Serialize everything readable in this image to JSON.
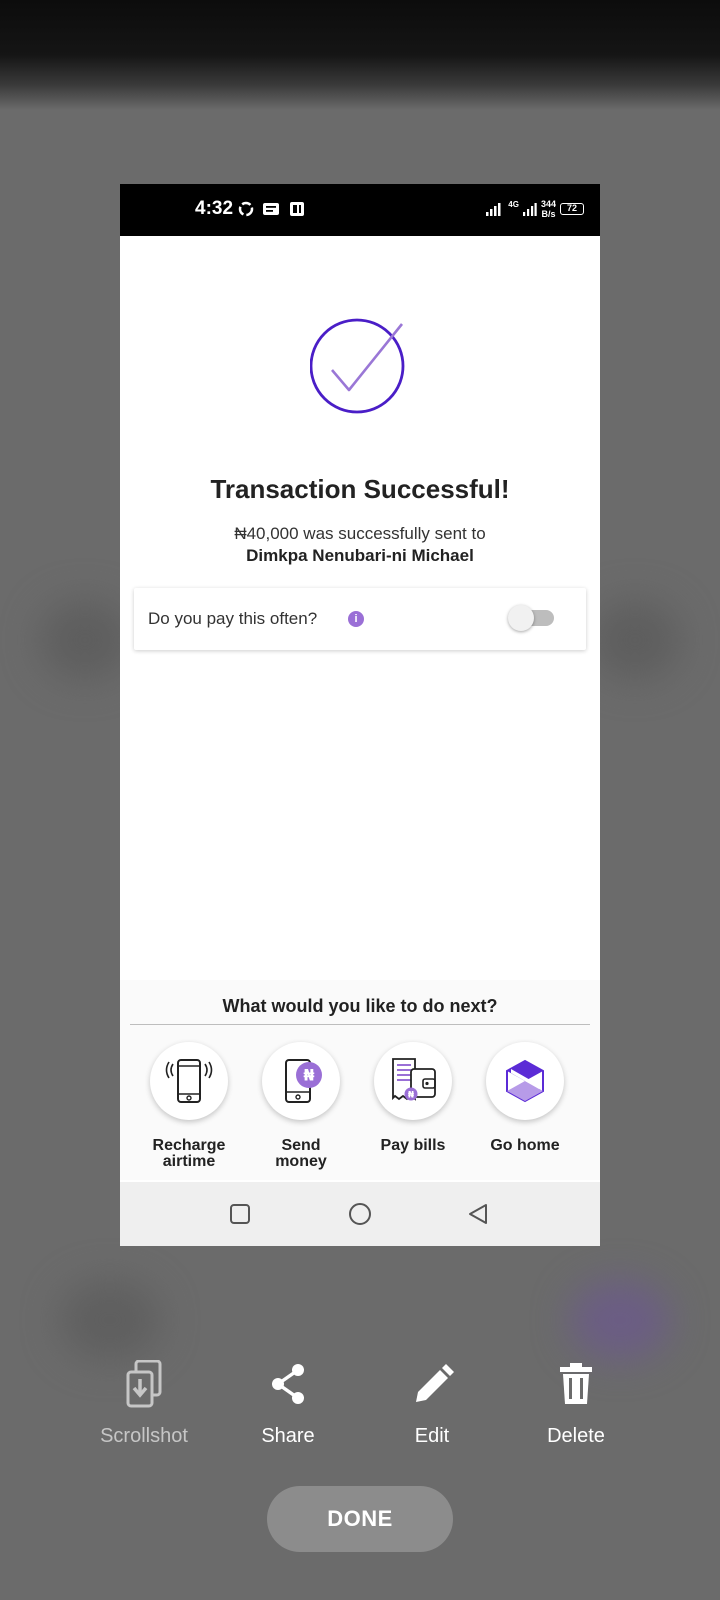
{
  "status_bar": {
    "time": "4:32",
    "network": "4G",
    "speed_value": "344",
    "speed_unit": "B/s",
    "battery": "72"
  },
  "receipt": {
    "title": "Transaction Successful!",
    "message": "₦40,000 was successfully sent to",
    "recipient": "Dimkpa Nenubari-ni Michael",
    "pay_often_label": "Do you pay this often?",
    "pay_often_enabled": false,
    "info_icon": "info-icon"
  },
  "next_actions": {
    "heading": "What would you like to do next?",
    "items": [
      {
        "label": "Recharge\nairtime",
        "icon": "phone-signal-icon"
      },
      {
        "label": "Send\nmoney",
        "icon": "phone-naira-icon"
      },
      {
        "label": "Pay bills",
        "icon": "bills-wallet-icon"
      },
      {
        "label": "Go home",
        "icon": "home-logo-icon"
      }
    ]
  },
  "nav_bar": {
    "buttons": [
      "recent-apps",
      "home",
      "back"
    ]
  },
  "screenshot_toolbar": {
    "scrollshot": "Scrollshot",
    "share": "Share",
    "edit": "Edit",
    "delete": "Delete",
    "done": "DONE"
  },
  "colors": {
    "accent_purple": "#4a1ec7",
    "light_purple": "#9a6fd6",
    "overlay_gray": "#6b6b6b"
  }
}
